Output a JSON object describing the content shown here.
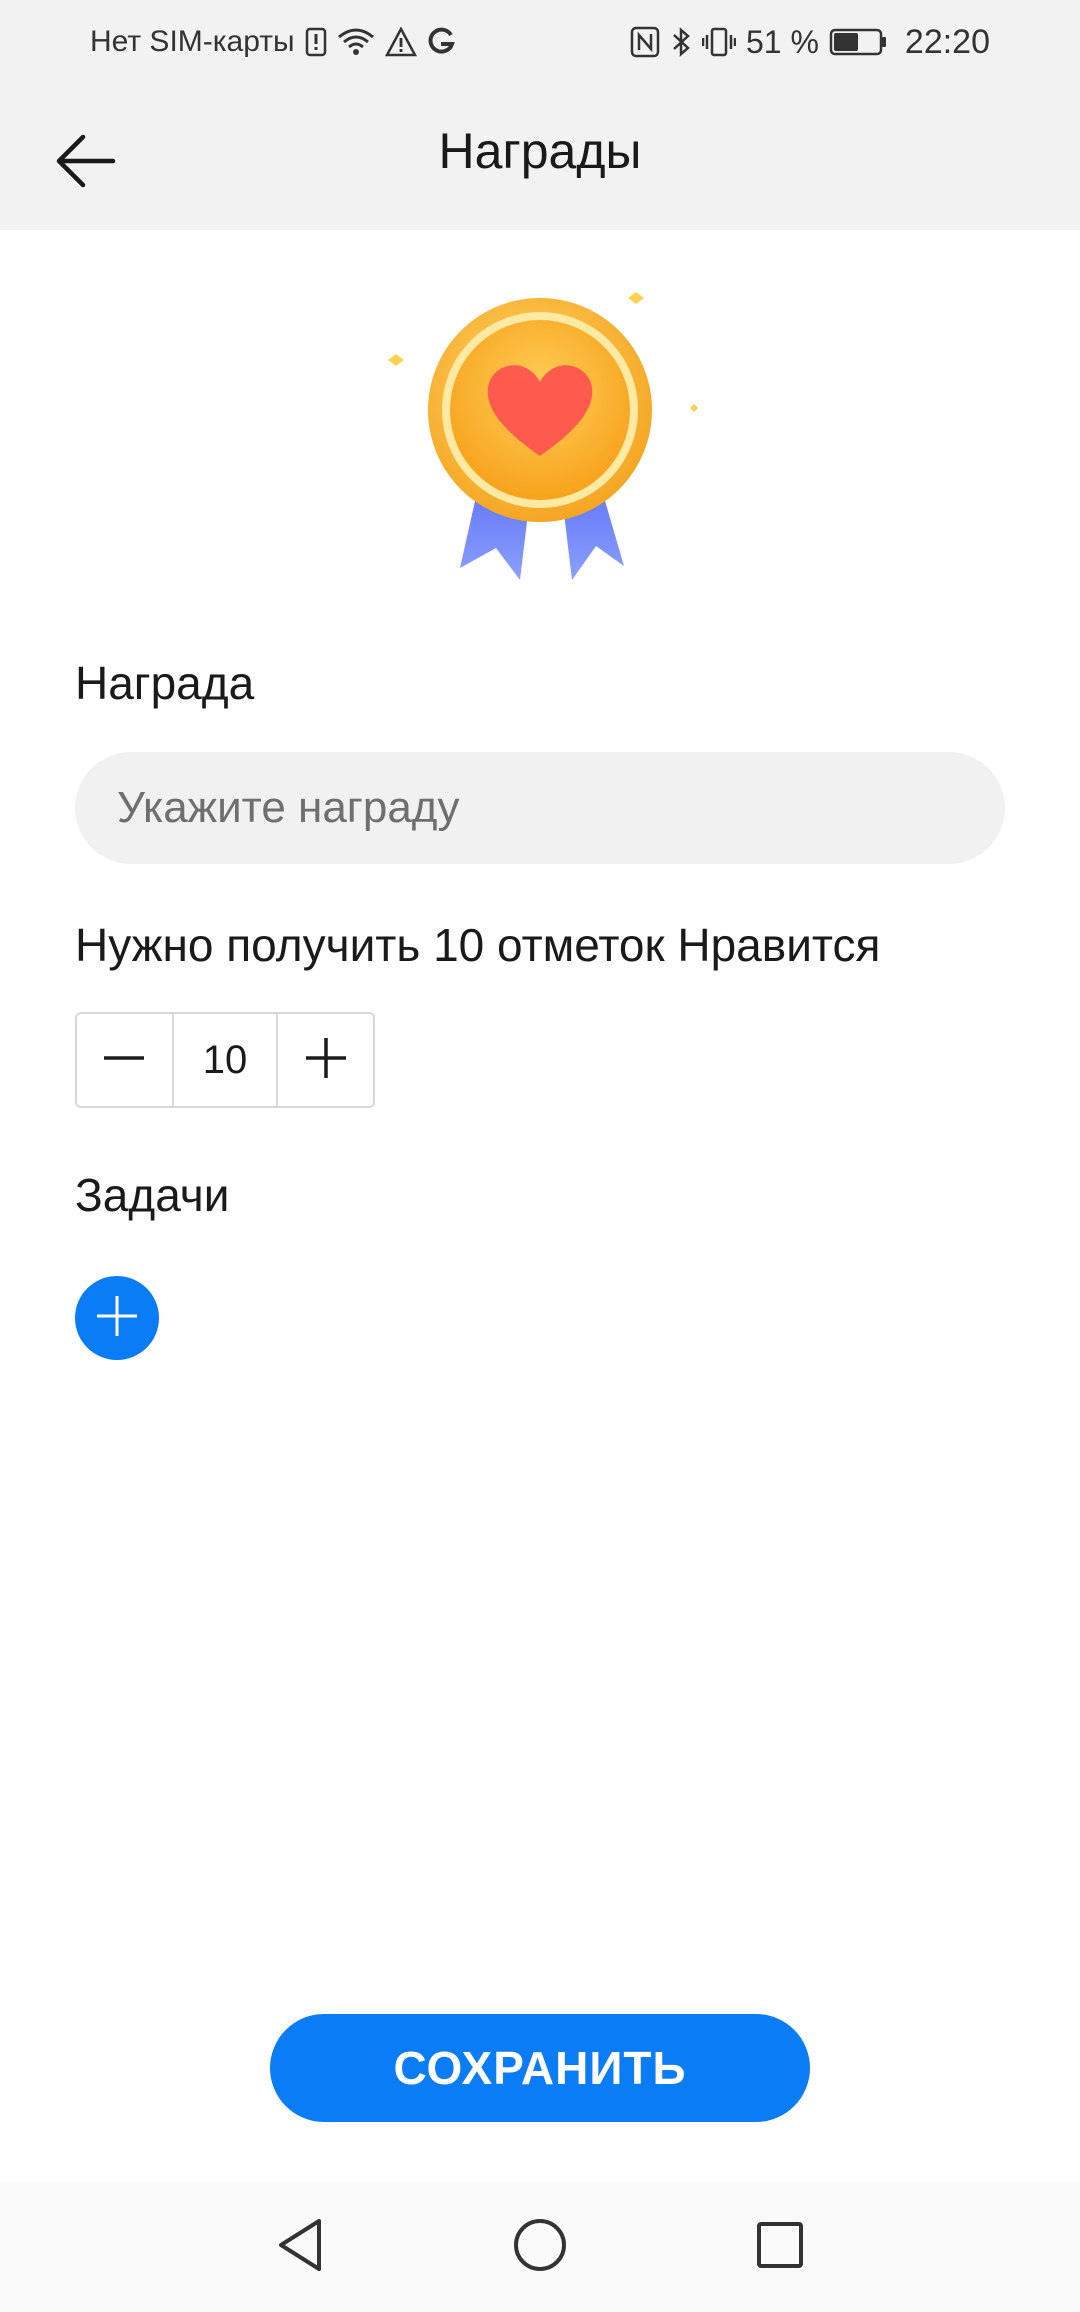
{
  "status_bar": {
    "carrier": "Нет SIM-карты",
    "battery_percent": "51 %",
    "time": "22:20"
  },
  "header": {
    "title": "Награды"
  },
  "form": {
    "reward_label": "Награда",
    "reward_input": {
      "placeholder": "Укажите награду",
      "value": ""
    },
    "likes_label": "Нужно получить 10 отметок Нравится",
    "likes_count": "10",
    "tasks_label": "Задачи"
  },
  "actions": {
    "save_label": "СОХРАНИТЬ"
  },
  "colors": {
    "accent": "#0a7cf5",
    "bar_background": "#f2f2f2",
    "medal_gold": "#f7b733",
    "heart": "#ff5a4e",
    "ribbon": "#6f86f7"
  },
  "icons": {
    "back": "arrow-left-icon",
    "minus": "minus-icon",
    "plus": "plus-icon",
    "add_task": "plus-icon",
    "nav_back": "triangle-back-icon",
    "nav_home": "circle-home-icon",
    "nav_recent": "square-recent-icon"
  }
}
